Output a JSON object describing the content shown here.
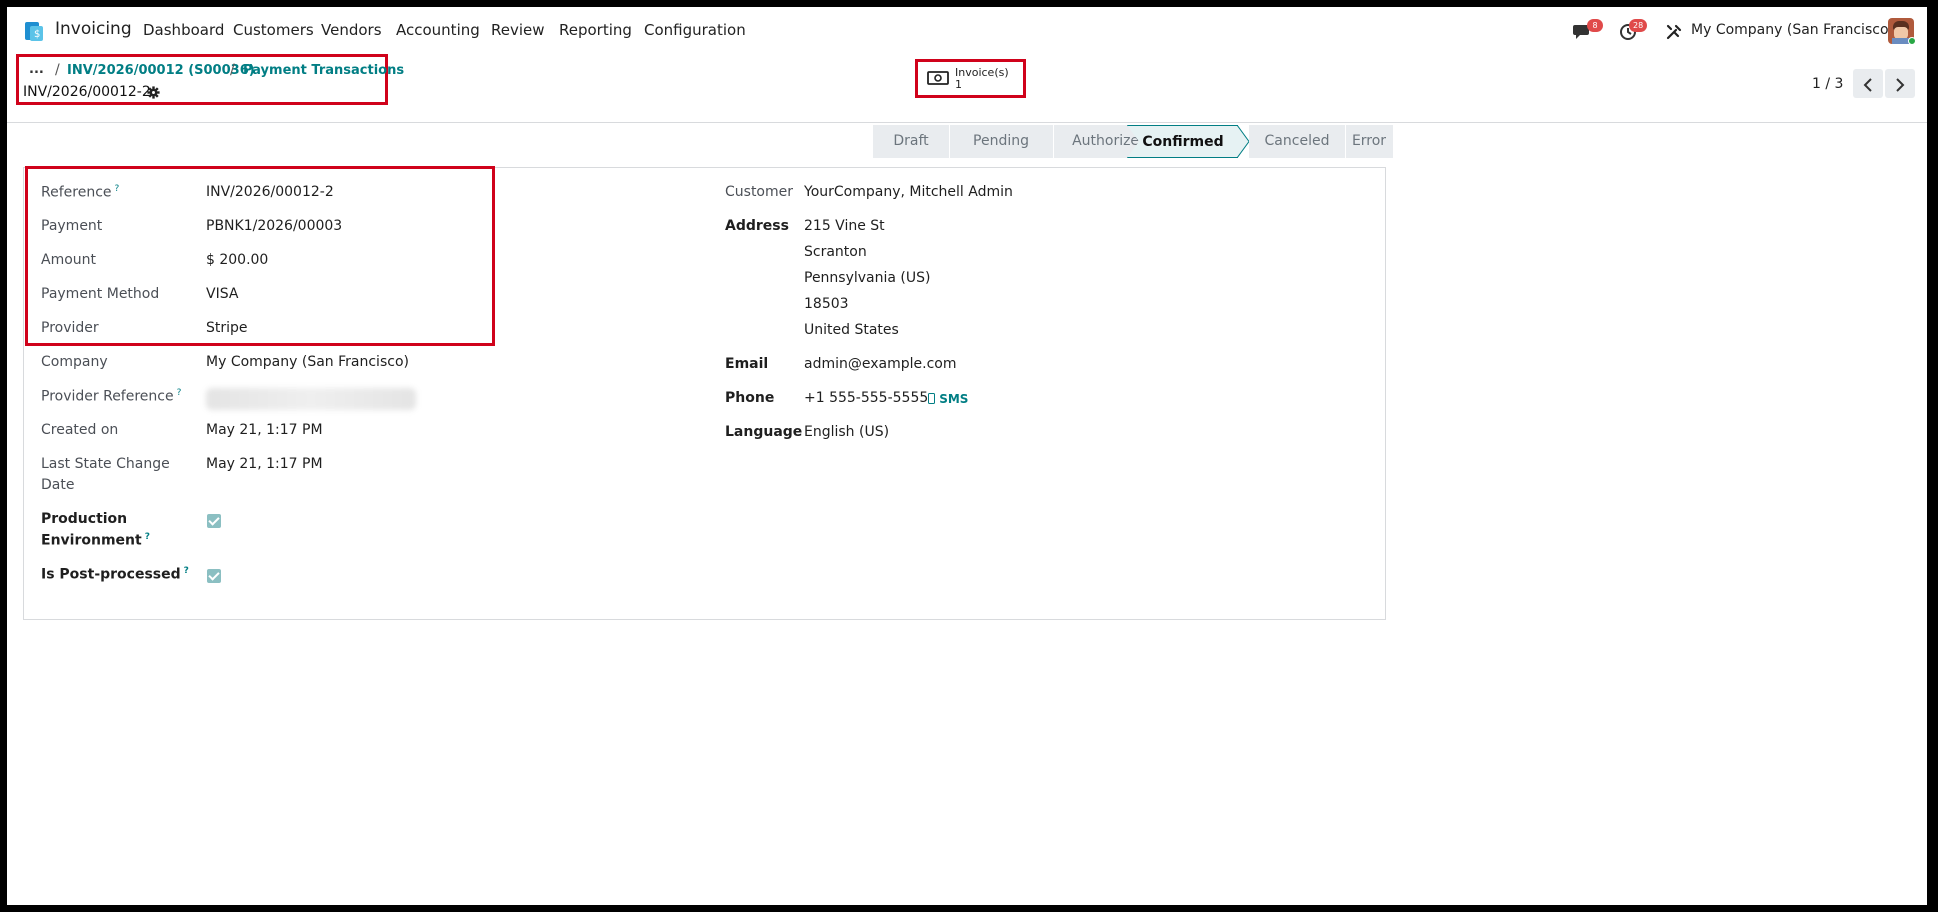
{
  "app": {
    "name": "Invoicing"
  },
  "nav": [
    "Dashboard",
    "Customers",
    "Vendors",
    "Accounting",
    "Review",
    "Reporting",
    "Configuration"
  ],
  "systray": {
    "messages_count": "8",
    "activities_count": "28",
    "company": "My Company (San Francisco)"
  },
  "breadcrumb": {
    "ellipsis": "...",
    "sep": "/",
    "items": [
      "INV/2026/00012 (S00036)",
      "Payment Transactions"
    ],
    "current": "INV/2026/00012-2"
  },
  "smart_button": {
    "label": "Invoice(s)",
    "count": "1"
  },
  "pager": {
    "value": "1 / 3"
  },
  "stages": [
    {
      "label": "Draft",
      "active": false
    },
    {
      "label": "Pending",
      "active": false
    },
    {
      "label": "Authorized",
      "active": false
    },
    {
      "label": "Confirmed",
      "active": true
    },
    {
      "label": "Canceled",
      "active": false
    },
    {
      "label": "Error",
      "active": false
    }
  ],
  "left_fields": {
    "reference": {
      "label": "Reference",
      "value": "INV/2026/00012-2"
    },
    "payment": {
      "label": "Payment",
      "value": "PBNK1/2026/00003"
    },
    "amount": {
      "label": "Amount",
      "value": "$ 200.00"
    },
    "payment_method": {
      "label": "Payment Method",
      "value": "VISA"
    },
    "provider": {
      "label": "Provider",
      "value": "Stripe"
    },
    "company": {
      "label": "Company",
      "value": "My Company (San Francisco)"
    },
    "provider_reference": {
      "label": "Provider Reference"
    },
    "created_on": {
      "label": "Created on",
      "value": "May 21, 1:17 PM"
    },
    "last_state_change": {
      "label_line1": "Last State Change",
      "label_line2": "Date",
      "value": "May 21, 1:17 PM"
    },
    "production_env": {
      "label_line1": "Production",
      "label_line2": "Environment",
      "checked": true
    },
    "post_processed": {
      "label": "Is Post-processed",
      "checked": true
    }
  },
  "right_fields": {
    "customer": {
      "label": "Customer",
      "value": "YourCompany, Mitchell Admin"
    },
    "address": {
      "label": "Address",
      "lines": [
        "215 Vine St",
        "Scranton",
        "Pennsylvania (US)",
        "18503",
        "United States"
      ]
    },
    "email": {
      "label": "Email",
      "value": "admin@example.com"
    },
    "phone": {
      "label": "Phone",
      "value": "+1 555-555-5555",
      "sms": "SMS"
    },
    "language": {
      "label": "Language",
      "value": "English (US)"
    }
  },
  "help_mark": "?"
}
